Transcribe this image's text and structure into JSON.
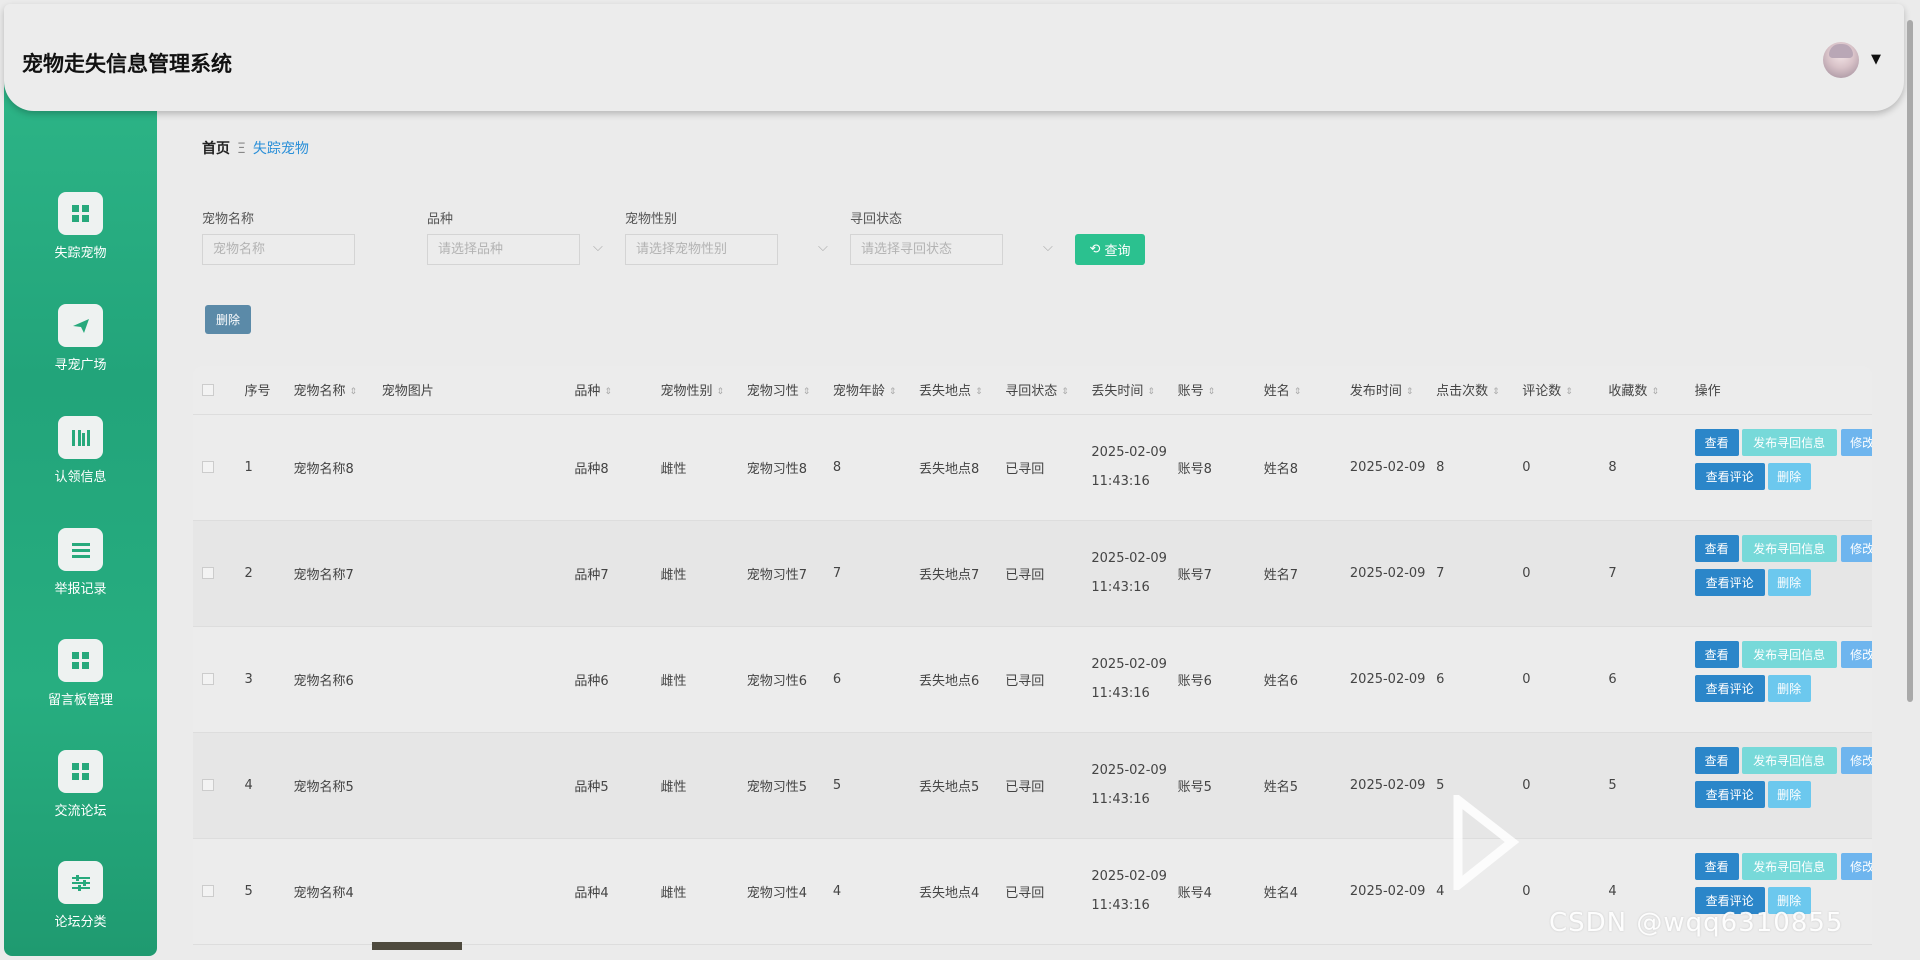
{
  "header": {
    "title": "宠物走失信息管理系统"
  },
  "sidebar": {
    "items": [
      {
        "label": "失踪宠物",
        "icon": "grid-icon"
      },
      {
        "label": "寻宠广场",
        "icon": "paper-plane-icon"
      },
      {
        "label": "认领信息",
        "icon": "book-icon"
      },
      {
        "label": "举报记录",
        "icon": "list-icon"
      },
      {
        "label": "留言板管理",
        "icon": "grid-icon"
      },
      {
        "label": "交流论坛",
        "icon": "grid-icon"
      },
      {
        "label": "论坛分类",
        "icon": "sliders-icon"
      }
    ]
  },
  "breadcrumb": {
    "home": "首页",
    "separator": "Ξ",
    "current": "失踪宠物"
  },
  "filters": {
    "name": {
      "label": "宠物名称",
      "placeholder": "宠物名称"
    },
    "breed": {
      "label": "品种",
      "placeholder": "请选择品种"
    },
    "gender": {
      "label": "宠物性别",
      "placeholder": "请选择宠物性别"
    },
    "status": {
      "label": "寻回状态",
      "placeholder": "请选择寻回状态"
    },
    "query_label": "查询"
  },
  "toolbar": {
    "delete_label": "删除"
  },
  "table": {
    "columns": [
      "序号",
      "宠物名称",
      "宠物图片",
      "品种",
      "宠物性别",
      "宠物习性",
      "宠物年龄",
      "丢失地点",
      "寻回状态",
      "丢失时间",
      "账号",
      "姓名",
      "发布时间",
      "点击次数",
      "评论数",
      "收藏数",
      "操作"
    ],
    "actions": {
      "view": "查看",
      "publish": "发布寻回信息",
      "edit": "修改",
      "comment": "查看评论",
      "delete": "删除"
    },
    "rows": [
      {
        "no": "1",
        "name": "宠物名称8",
        "breed": "品种8",
        "gender": "雌性",
        "habit": "宠物习性8",
        "age": "8",
        "place": "丢失地点8",
        "status": "已寻回",
        "lost_date": "2025-02-09",
        "lost_time": "11:43:16",
        "account": "账号8",
        "person": "姓名8",
        "publish": "2025-02-09",
        "clicks": "8",
        "comments": "0",
        "favorites": "8"
      },
      {
        "no": "2",
        "name": "宠物名称7",
        "breed": "品种7",
        "gender": "雌性",
        "habit": "宠物习性7",
        "age": "7",
        "place": "丢失地点7",
        "status": "已寻回",
        "lost_date": "2025-02-09",
        "lost_time": "11:43:16",
        "account": "账号7",
        "person": "姓名7",
        "publish": "2025-02-09",
        "clicks": "7",
        "comments": "0",
        "favorites": "7"
      },
      {
        "no": "3",
        "name": "宠物名称6",
        "breed": "品种6",
        "gender": "雌性",
        "habit": "宠物习性6",
        "age": "6",
        "place": "丢失地点6",
        "status": "已寻回",
        "lost_date": "2025-02-09",
        "lost_time": "11:43:16",
        "account": "账号6",
        "person": "姓名6",
        "publish": "2025-02-09",
        "clicks": "6",
        "comments": "0",
        "favorites": "6"
      },
      {
        "no": "4",
        "name": "宠物名称5",
        "breed": "品种5",
        "gender": "雌性",
        "habit": "宠物习性5",
        "age": "5",
        "place": "丢失地点5",
        "status": "已寻回",
        "lost_date": "2025-02-09",
        "lost_time": "11:43:16",
        "account": "账号5",
        "person": "姓名5",
        "publish": "2025-02-09",
        "clicks": "5",
        "comments": "0",
        "favorites": "5"
      },
      {
        "no": "5",
        "name": "宠物名称4",
        "breed": "品种4",
        "gender": "雌性",
        "habit": "宠物习性4",
        "age": "4",
        "place": "丢失地点4",
        "status": "已寻回",
        "lost_date": "2025-02-09",
        "lost_time": "11:43:16",
        "account": "账号4",
        "person": "姓名4",
        "publish": "2025-02-09",
        "clicks": "4",
        "comments": "0",
        "favorites": "4"
      }
    ]
  },
  "watermark": "CSDN @wqq6310855",
  "colors": {
    "sidebar": "#27ae80",
    "accent": "#2bc18f",
    "primary_button": "#2b86c9",
    "link": "#2a8fd8"
  }
}
